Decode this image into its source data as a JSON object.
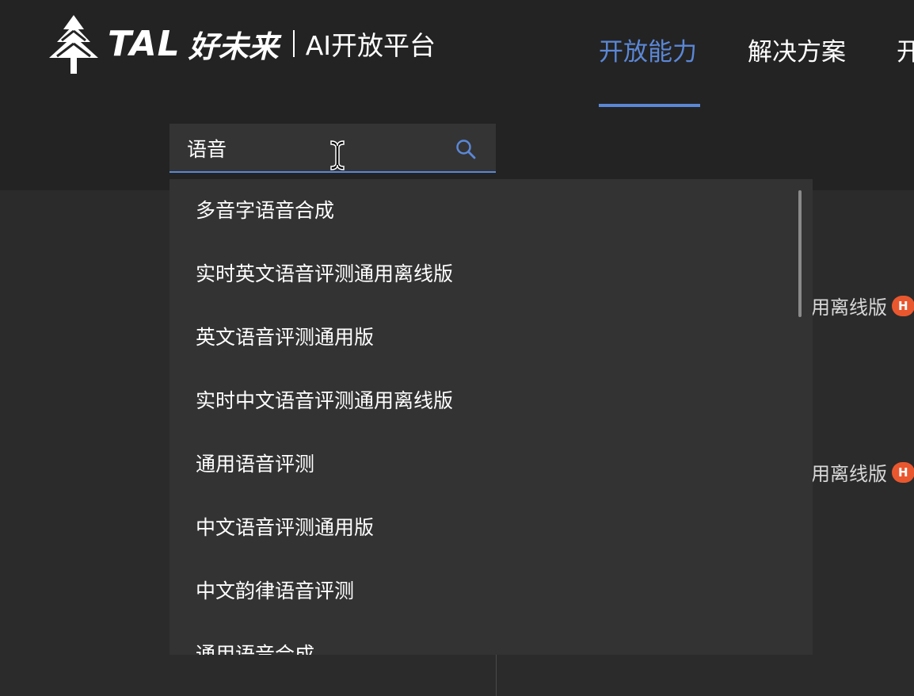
{
  "logo": {
    "icon": "tree-logo-icon",
    "brand_en": "TAL",
    "brand_cn": "好未来",
    "platform": "AI开放平台"
  },
  "nav": {
    "items": [
      {
        "label": "开放能力",
        "active": true
      },
      {
        "label": "解决方案",
        "active": false
      },
      {
        "label": "开",
        "active": false
      }
    ]
  },
  "search": {
    "value": "语音",
    "icon": "search-icon"
  },
  "suggestions": [
    "多音字语音合成",
    "实时英文语音评测通用离线版",
    "英文语音评测通用版",
    "实时中文语音评测通用离线版",
    "通用语音评测",
    "中文语音评测通用版",
    "中文韵律语音评测",
    "通用语音合成"
  ],
  "background_cards": [
    {
      "label": "用离线版",
      "badge": "H"
    },
    {
      "label": "用离线版",
      "badge": "H"
    }
  ],
  "colors": {
    "accent": "#5b87d6",
    "badge": "#e9572f",
    "header_bg": "#232323",
    "dropdown_bg": "#333333"
  }
}
